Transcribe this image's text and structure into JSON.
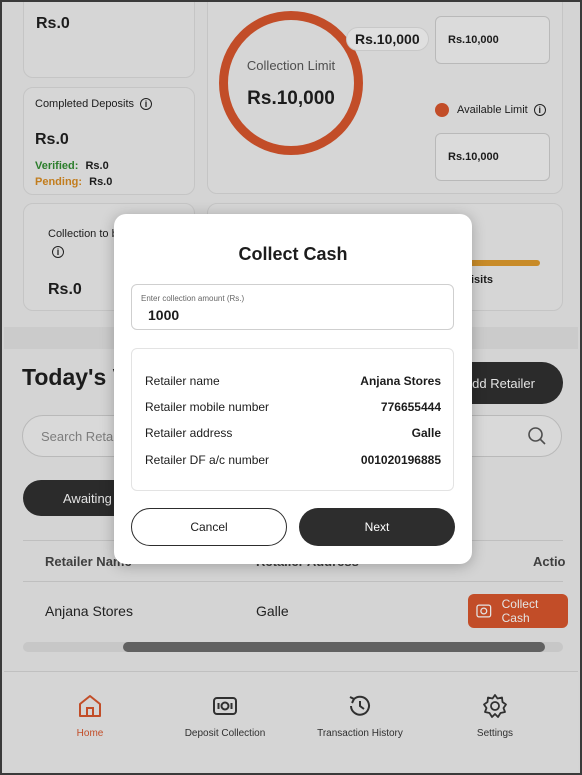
{
  "dashboard": {
    "top_left_value": "Rs.0",
    "collection_limit": {
      "label": "Collection Limit",
      "value": "Rs.10,000",
      "pill": "Rs.10,000"
    },
    "right_box_top": "Rs.10,000",
    "available_limit_label": "Available Limit",
    "right_box_bottom": "Rs.10,000",
    "completed_deposits": {
      "title": "Completed Deposits",
      "value": "Rs.0",
      "verified_label": "Verified:",
      "verified_value": "Rs.0",
      "pending_label": "Pending:",
      "pending_value": "Rs.0"
    },
    "collection_tb": {
      "title": "Collection to b",
      "value": "Rs.0"
    },
    "visits_label": "isits"
  },
  "section": {
    "title": "Today's V",
    "add_retailer": "Add Retailer",
    "search_placeholder": "Search Reta",
    "filter_tab": "Awaiting C"
  },
  "table": {
    "headers": [
      "Retailer Name",
      "Retailer Address",
      "Actio"
    ],
    "rows": [
      {
        "name": "Anjana Stores",
        "address": "Galle",
        "action": "Collect Cash"
      }
    ]
  },
  "nav": {
    "items": [
      {
        "label": "Home",
        "icon": "home-icon",
        "active": true
      },
      {
        "label": "Deposit Collection",
        "icon": "cash-icon",
        "active": false
      },
      {
        "label": "Transaction History",
        "icon": "history-icon",
        "active": false
      },
      {
        "label": "Settings",
        "icon": "gear-icon",
        "active": false
      }
    ]
  },
  "modal": {
    "title": "Collect Cash",
    "amount_label": "Enter collection amount (Rs.)",
    "amount_value": "1000",
    "details": [
      {
        "label": "Retailer name",
        "value": "Anjana Stores"
      },
      {
        "label": "Retailer mobile number",
        "value": "776655444"
      },
      {
        "label": "Retailer address",
        "value": "Galle"
      },
      {
        "label": "Retailer DF a/c number",
        "value": "001020196885"
      }
    ],
    "cancel_label": "Cancel",
    "next_label": "Next"
  },
  "colors": {
    "accent": "#d9542a",
    "verified": "#2e8b2e",
    "pending": "#d98a1e",
    "dark_button": "#2d2d2d"
  }
}
